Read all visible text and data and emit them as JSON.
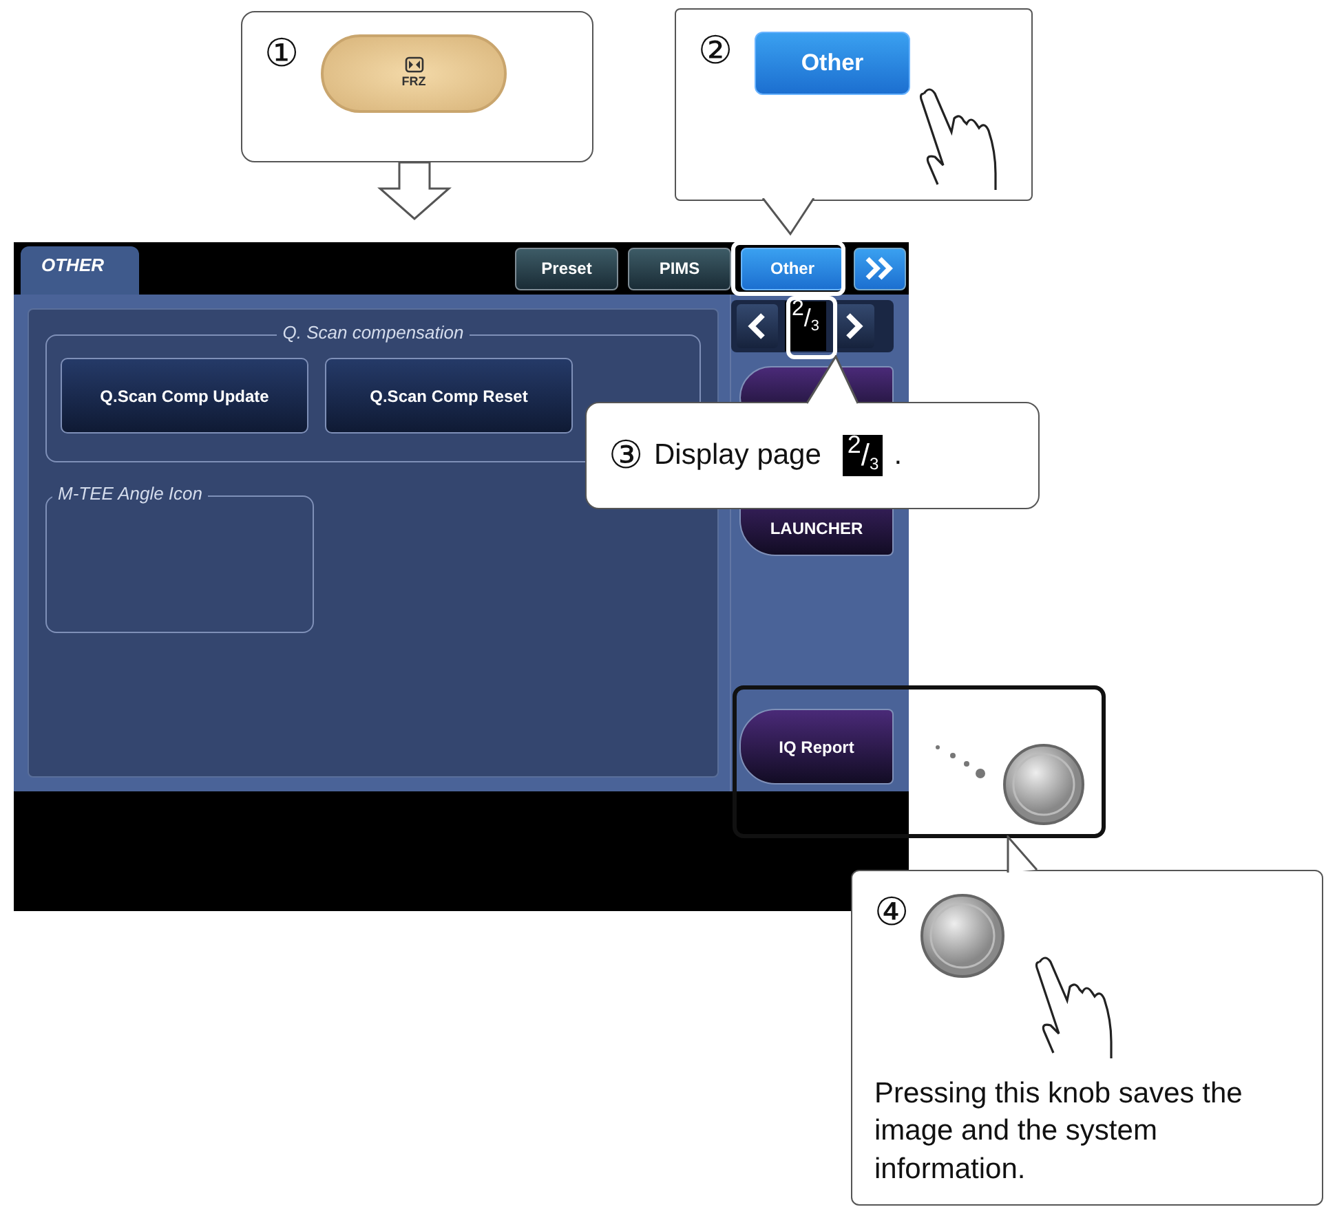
{
  "screen": {
    "tab": {
      "label": "OTHER"
    },
    "mode_buttons": [
      {
        "label": "Preset",
        "selected": false
      },
      {
        "label": "PIMS",
        "selected": false
      },
      {
        "label": "Other",
        "selected": true
      }
    ],
    "pager": {
      "indicator": "$^{2}$/$_{3}$"
    },
    "groups": [
      {
        "title": "Q. Scan compensation",
        "buttons": [
          "Q.Scan Comp Update",
          "Q.Scan Comp Reset"
        ]
      },
      {
        "title": "M-TEE Angle Icon"
      }
    ],
    "side_buttons": [
      {
        "label": "LAUNCHER"
      },
      {
        "label": "IQ Report"
      }
    ]
  },
  "callouts": [
    {
      "kind": "key",
      "marker": "①",
      "key_label": "FRZ"
    },
    {
      "kind": "button",
      "marker": "②",
      "button_label": "Other"
    },
    {
      "kind": "text",
      "marker": "③",
      "text": "Display page",
      "indicator": "$^{2}$/$_{3}$",
      "end": "."
    },
    {
      "kind": "knob",
      "marker": "④",
      "text": "Pressing this knob saves the image and the system information."
    }
  ]
}
